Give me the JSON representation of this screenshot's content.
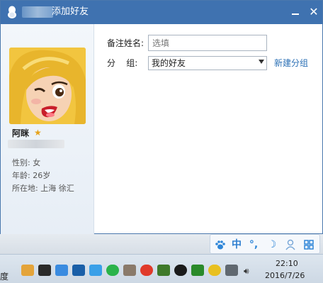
{
  "window": {
    "title": "添加好友",
    "minimize_icon": "minimize-icon",
    "close_icon": "close-icon"
  },
  "profile": {
    "nickname": "阿眯",
    "gender_text": "性别: 女",
    "age_text": "年龄: 26岁",
    "location_text": "所在地: 上海  徐汇"
  },
  "form": {
    "remark_label": "备注姓名:",
    "remark_placeholder": "选填",
    "group_label": "分    组:",
    "group_value": "我的好友",
    "new_group_link": "新建分组"
  },
  "ime": {
    "mode": "中",
    "punct": "°,",
    "paw_icon": "paw-icon",
    "moon_icon": "moon-icon",
    "user_icon": "user-icon",
    "grid_icon": "grid-icon"
  },
  "taskbar": {
    "edge_text": "度",
    "clock_time": "22:10",
    "clock_date": "2016/7/26"
  },
  "colors": {
    "titlebar": "#3f72b0",
    "link": "#2a6fb5",
    "accent": "#2f86d8"
  }
}
